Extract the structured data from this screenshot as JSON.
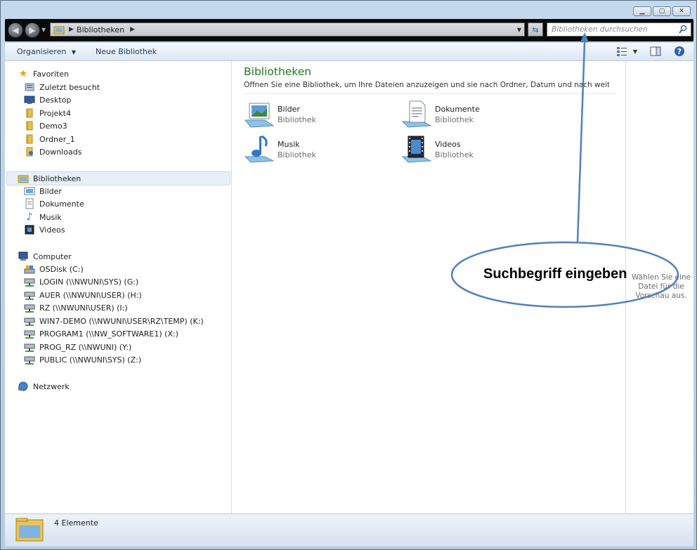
{
  "address_bar": {
    "crumb": "Bibliotheken",
    "search_placeholder": "Bibliotheken durchsuchen"
  },
  "toolbar": {
    "organize_label": "Organisieren",
    "new_library_label": "Neue Bibliothek"
  },
  "nav": {
    "favorites": {
      "label": "Favoriten",
      "items": [
        "Zuletzt besucht",
        "Desktop",
        "Projekt4",
        "Demo3",
        "Ordner_1",
        "Downloads"
      ]
    },
    "libraries": {
      "label": "Bibliotheken",
      "items": [
        "Bilder",
        "Dokumente",
        "Musik",
        "Videos"
      ]
    },
    "computer": {
      "label": "Computer",
      "items": [
        "OSDisk (C:)",
        "LOGIN (\\\\NWUNI\\SYS) (G:)",
        "AUER (\\\\NWUNI\\USER) (H:)",
        "RZ (\\\\NWUNI\\USER) (I:)",
        "WIN7-DEMO (\\\\NWUNI\\USER\\RZ\\TEMP) (K:)",
        "PROGRAM1 (\\\\NW_SOFTWARE1) (X:)",
        "PROG_RZ (\\\\NWUNI) (Y:)",
        "PUBLIC (\\\\NWUNI\\SYS) (Z:)"
      ]
    },
    "network": {
      "label": "Netzwerk"
    }
  },
  "main": {
    "title": "Bibliotheken",
    "subtitle": "Öffnen Sie eine Bibliothek, um Ihre Dateien anzuzeigen und sie nach Ordner, Datum und nach weiteren Eigen...",
    "libraries": [
      {
        "name": "Bilder",
        "type": "Bibliothek"
      },
      {
        "name": "Dokumente",
        "type": "Bibliothek"
      },
      {
        "name": "Musik",
        "type": "Bibliothek"
      },
      {
        "name": "Videos",
        "type": "Bibliothek"
      }
    ]
  },
  "preview": {
    "text": "Wählen Sie eine Datei für die Vorschau aus."
  },
  "status": {
    "count": "4 Elemente"
  },
  "annotation": {
    "callout": "Suchbegriff eingeben"
  },
  "colors": {
    "title_green": "#1e7a1e",
    "annotation_blue": "#4f81bd"
  }
}
